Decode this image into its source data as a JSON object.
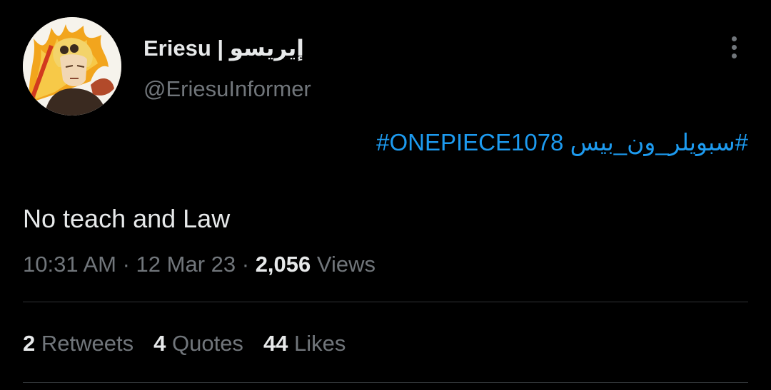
{
  "author": {
    "display_name": "Eriesu | إيريسو",
    "handle": "@EriesuInformer"
  },
  "tweet": {
    "hashtag_arabic": "#سبويلر_ون_بيس",
    "hashtag_english": "#ONEPIECE1078",
    "text": "No teach and Law",
    "time": "10:31 AM",
    "separator": " · ",
    "date": "12 Mar 23",
    "views_count": "2,056",
    "views_label": "Views"
  },
  "stats": {
    "retweets_count": "2",
    "retweets_label": "Retweets",
    "quotes_count": "4",
    "quotes_label": "Quotes",
    "likes_count": "44",
    "likes_label": "Likes"
  },
  "colors": {
    "background": "#000000",
    "primary_text": "#e7e9ea",
    "secondary_text": "#71767b",
    "link": "#1d9bf0",
    "divider": "#2f3336"
  },
  "icons": {
    "more": "more-vertical-icon"
  }
}
